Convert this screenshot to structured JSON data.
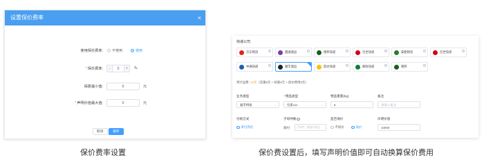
{
  "left_dialog": {
    "title": "设置保价费率",
    "close_icon": "×",
    "use_rate": {
      "label": "使用保价费率:",
      "options": [
        "不使用",
        "使用"
      ],
      "selected": "使用"
    },
    "rate": {
      "label": "保价费率:",
      "value": "0",
      "minus": "-",
      "plus": "+",
      "unit": "‰"
    },
    "min_fee": {
      "label": "保费最小值:",
      "value": "0",
      "unit": "元"
    },
    "declared_max": {
      "label": "声明价值最大值:",
      "value": "0",
      "unit": "元"
    },
    "buttons": {
      "cancel": "取消",
      "ok": "保存"
    }
  },
  "right_panel": {
    "section_title": "快递公司",
    "carriers": [
      {
        "name": "京东物流",
        "logo_color": "#e1251b"
      },
      {
        "name": "圆通速运",
        "logo_color": "#7b3fa0"
      },
      {
        "name": "德邦快递",
        "logo_color": "#1a5e1a"
      },
      {
        "name": "百世快递",
        "logo_color": "#d0021b"
      },
      {
        "name": "安能物流",
        "logo_color": "#2d7a2d"
      },
      {
        "name": "百世快递",
        "logo_color": "#d0021b"
      },
      {
        "name": "中通快递",
        "logo_color": "#1f5fae"
      },
      {
        "name": "顺丰速运",
        "logo_color": "#222222",
        "selected": true
      },
      {
        "name": "韵达快递",
        "logo_color": "#f5c400"
      },
      {
        "name": "邮政快递",
        "logo_color": "#0a7d3b"
      },
      {
        "name": "德邦",
        "logo_color": "#1a5e1a"
      }
    ],
    "fee_prefix": "预计运费: ",
    "fee_highlight": "12元",
    "fee_detail": "（首重8元 + 续重4元 + 保价费用0元）",
    "fields_row1": [
      {
        "label": "业务类型",
        "required": false,
        "value": "顺丰特快",
        "placeholder": false,
        "caret": "⌄"
      },
      {
        "label": "物品类型",
        "required": true,
        "value": "包裹111",
        "placeholder": false,
        "caret": "⌄"
      },
      {
        "label": "物品重量(kg)",
        "required": false,
        "value": "5",
        "placeholder": false,
        "caret": ""
      },
      {
        "label": "备注",
        "required": false,
        "value": "请输入备注",
        "placeholder": true,
        "caret": ""
      }
    ],
    "row2_labels": {
      "payment": "付款方式",
      "sub_account": "子母件数",
      "insured": "是否保价",
      "declared": "声明价值"
    },
    "payment_option": "寄付月结",
    "sub_prefix": "顺付",
    "sub_placeholder": "子母件，数量不超过",
    "insured_options": [
      "不保价",
      "保价"
    ],
    "insured_selected": "保价",
    "declared_value": "10000",
    "help_glyph": "?"
  },
  "captions": {
    "left": "保价费率设置",
    "right": "保价费设置后，填写声明价值即可自动换算保价费用"
  },
  "colors": {
    "primary": "#409eff",
    "header": "#4a9ff0",
    "highlight": "#e6a23c"
  }
}
